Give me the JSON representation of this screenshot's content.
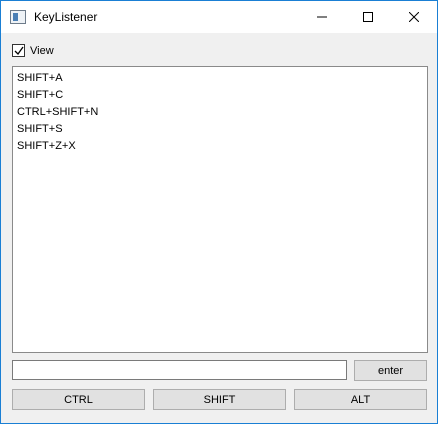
{
  "window": {
    "title": "KeyListener"
  },
  "view_checkbox": {
    "label": "View",
    "checked": true
  },
  "log": {
    "lines": [
      "SHIFT+A",
      "SHIFT+C",
      "CTRL+SHIFT+N",
      "SHIFT+S",
      "SHIFT+Z+X"
    ]
  },
  "entry": {
    "value": ""
  },
  "buttons": {
    "enter": "enter",
    "ctrl": "CTRL",
    "shift": "SHIFT",
    "alt": "ALT"
  },
  "icons": {
    "app": "window-app-icon",
    "minimize": "minimize-icon",
    "maximize": "maximize-icon",
    "close": "close-icon",
    "check": "checkmark-icon"
  },
  "colors": {
    "window_border": "#1a7fd4",
    "window_bg": "#f0f0f0",
    "button_bg": "#e1e1e1"
  }
}
